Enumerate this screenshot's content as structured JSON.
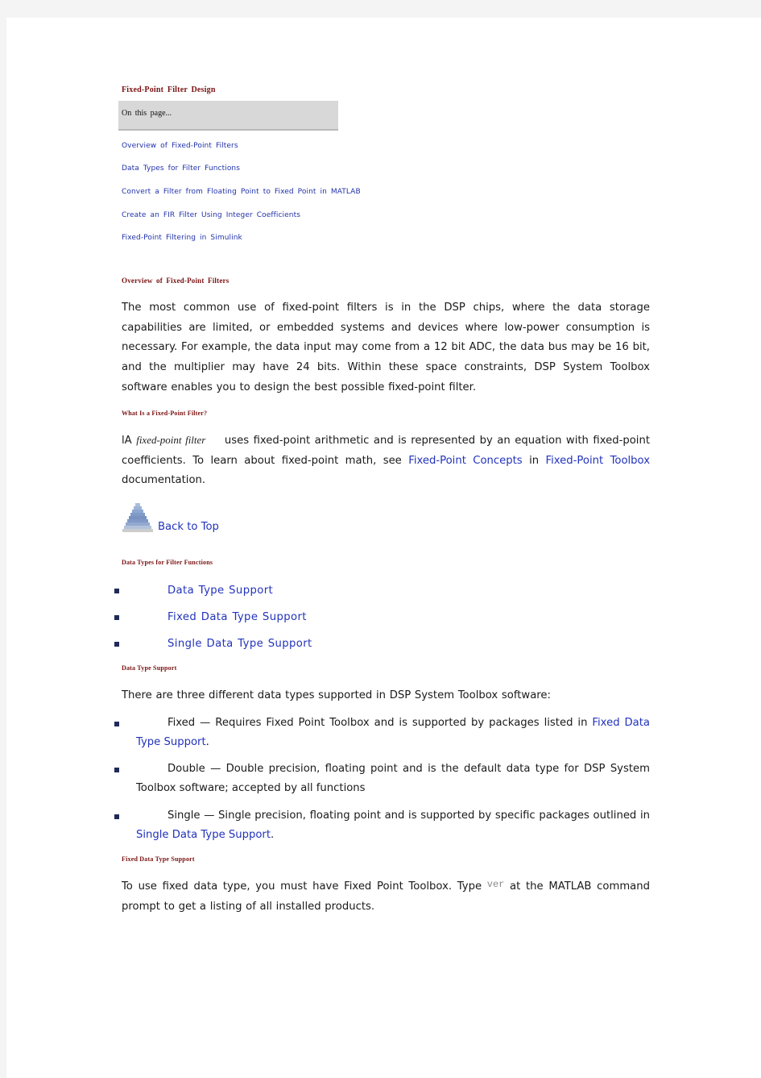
{
  "page": {
    "title": "Fixed-Point Filter Design",
    "toc": {
      "heading": "On this page...",
      "links": [
        "Overview of Fixed-Point Filters",
        "Data Types for Filter Functions",
        "Convert a Filter from Floating Point to Fixed Point in MATLAB",
        "Create an FIR Filter Using Integer Coefficients",
        "Fixed-Point Filtering in Simulink"
      ]
    },
    "overview": {
      "heading": "Overview of Fixed-Point Filters",
      "body": "The most common use of fixed-point filters is in the DSP chips, where the data storage capabilities are limited, or embedded systems and devices where low-power consumption is necessary. For example, the data input may come from a 12 bit ADC, the data bus may be 16 bit, and the multiplier may have 24 bits. Within these space constraints, DSP System Toolbox software enables you to design the best possible fixed-point filter."
    },
    "what_is": {
      "heading": "What Is a Fixed-Point Filter?",
      "prefix": "lA ",
      "term": "fixed-point filter",
      "text1": " uses fixed-point arithmetic and is represented by an equation with fixed-point coefficients. To learn about fixed-point math, see ",
      "link1": "Fixed-Point Concepts",
      "text2": " in ",
      "link2": "Fixed-Point Toolbox",
      "text3": " documentation."
    },
    "back_to_top": {
      "label": "Back to Top",
      "icon": "pyramid-up-icon"
    },
    "data_types": {
      "heading": "Data Types for Filter Functions",
      "links": [
        "Data Type Support",
        "Fixed Data Type Support",
        "Single Data Type Support"
      ]
    },
    "data_type_support": {
      "heading": "Data Type Support",
      "intro": "There are three different data types supported in DSP System Toolbox software:",
      "items": [
        {
          "text": "Fixed — Requires Fixed Point Toolbox and is supported by packages listed in ",
          "link": "Fixed Data Type Support",
          "suffix": "."
        },
        {
          "text": "Double — Double precision, floating point and is the default data type for DSP System Toolbox software; accepted by all functions",
          "link": "",
          "suffix": ""
        },
        {
          "text": "Single — Single precision, floating point and is supported by specific packages outlined in ",
          "link": "Single Data Type Support",
          "suffix": "."
        }
      ]
    },
    "fixed_support": {
      "heading": "Fixed Data Type Support",
      "text1": "To use fixed data type, you must have Fixed Point Toolbox. Type ",
      "code": "ver",
      "text2": " at the MATLAB command prompt to get a listing of all installed products."
    }
  },
  "colors": {
    "heading": "#7a1212",
    "link": "#2233bb",
    "toc_bg": "#d8d8d8",
    "bullet": "#1f2a5a"
  }
}
